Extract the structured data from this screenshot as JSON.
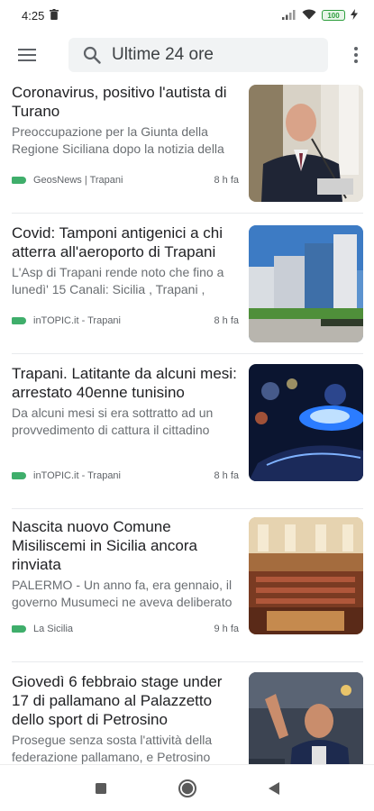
{
  "status_bar": {
    "time": "4:25",
    "battery": "100"
  },
  "search": {
    "query": "Ultime 24 ore"
  },
  "articles": [
    {
      "headline": "Coronavirus, positivo l'autista di Turano",
      "snippet": "Preoccupazione per la Giunta della Regione Siciliana dopo la notizia della",
      "source": "GeosNews | Trapani",
      "time": "8 h fa"
    },
    {
      "headline": "Covid: Tamponi antigenici a chi atterra all'aeroporto di Trapani",
      "snippet": "L'Asp di Trapani rende noto che fino a lunedì' 15 Canali: Sicilia , Trapani ,",
      "source": "inTOPIC.it - Trapani",
      "time": "8 h fa"
    },
    {
      "headline": "Trapani. Latitante da alcuni mesi: arrestato 40enne tunisino",
      "snippet": "Da alcuni mesi si era sottratto ad un provvedimento di cattura il cittadino",
      "source": "inTOPIC.it - Trapani",
      "time": "8 h fa"
    },
    {
      "headline": "Nascita nuovo Comune Misiliscemi in Sicilia ancora rinviata",
      "snippet": "PALERMO - Un anno fa, era gennaio, il governo Musumeci ne aveva deliberato",
      "source": "La Sicilia",
      "time": "9 h fa"
    },
    {
      "headline": "Giovedì 6 febbraio stage under 17 di pallamano al Palazzetto dello sport di Petrosino",
      "snippet": "Prosegue senza sosta l'attività della federazione pallamano, e Petrosino"
    }
  ]
}
